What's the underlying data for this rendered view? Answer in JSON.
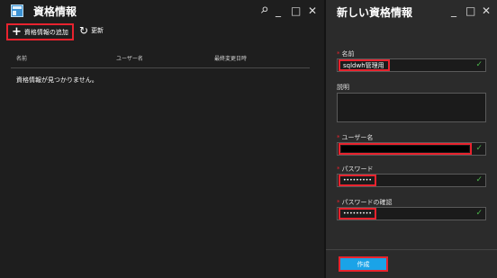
{
  "left_panel": {
    "title": "資格情報",
    "controls": {
      "pin": "✚",
      "minimize": "_",
      "maximize": "□",
      "close": "✕"
    },
    "toolbar": {
      "add_label": "資格情報の追加",
      "refresh_label": "更新"
    },
    "table": {
      "columns": [
        "名前",
        "ユーザー名",
        "最終変更日時"
      ],
      "empty_message": "資格情報が見つかりません。"
    }
  },
  "right_panel": {
    "title": "新しい資格情報",
    "controls": {
      "minimize": "_",
      "maximize": "□",
      "close": "✕"
    },
    "fields": {
      "name": {
        "label": "名前",
        "required": "*",
        "value": "sqldwh管理用",
        "check": "✓"
      },
      "description": {
        "label": "説明",
        "value": ""
      },
      "username": {
        "label": "ユーザー名",
        "required": "*",
        "value": "",
        "check": "✓"
      },
      "password": {
        "label": "パスワード",
        "required": "*",
        "value": "•••••••••",
        "check": "✓"
      },
      "confirm_password": {
        "label": "パスワードの確認",
        "required": "*",
        "value": "•••••••••",
        "check": "✓"
      }
    },
    "create_label": "作成"
  },
  "colors": {
    "highlight": "#e8232e",
    "accent": "#1aa3e8",
    "check": "#4ab44a",
    "left_bg": "#1e1e1e",
    "right_bg": "#2b2b2b"
  }
}
